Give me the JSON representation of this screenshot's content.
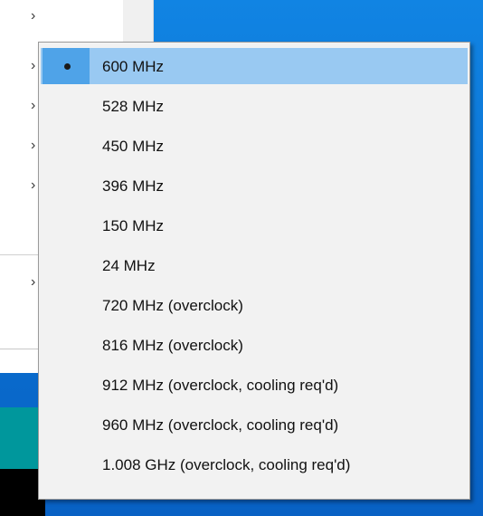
{
  "parent_menu": {
    "chevron_glyph": "›",
    "rows": [
      {
        "has_submenu": true
      },
      {
        "has_submenu": true
      },
      {
        "has_submenu": true
      },
      {
        "has_submenu": true
      },
      {
        "has_submenu": true
      },
      {
        "has_submenu": true
      }
    ]
  },
  "submenu": {
    "selected_index": 0,
    "items": [
      {
        "label": "600 MHz"
      },
      {
        "label": "528 MHz"
      },
      {
        "label": "450 MHz"
      },
      {
        "label": "396 MHz"
      },
      {
        "label": "150 MHz"
      },
      {
        "label": "24 MHz"
      },
      {
        "label": "720 MHz (overclock)"
      },
      {
        "label": "816 MHz (overclock)"
      },
      {
        "label": "912 MHz (overclock, cooling req'd)"
      },
      {
        "label": "960 MHz (overclock, cooling req'd)"
      },
      {
        "label": "1.008 GHz (overclock, cooling req'd)"
      }
    ]
  },
  "colors": {
    "desktop": "#0a78d7",
    "menu_bg": "#f2f2f2",
    "highlight": "#99c9f2",
    "highlight_gutter": "#4fa3e8",
    "ide_teal": "#00979c"
  }
}
